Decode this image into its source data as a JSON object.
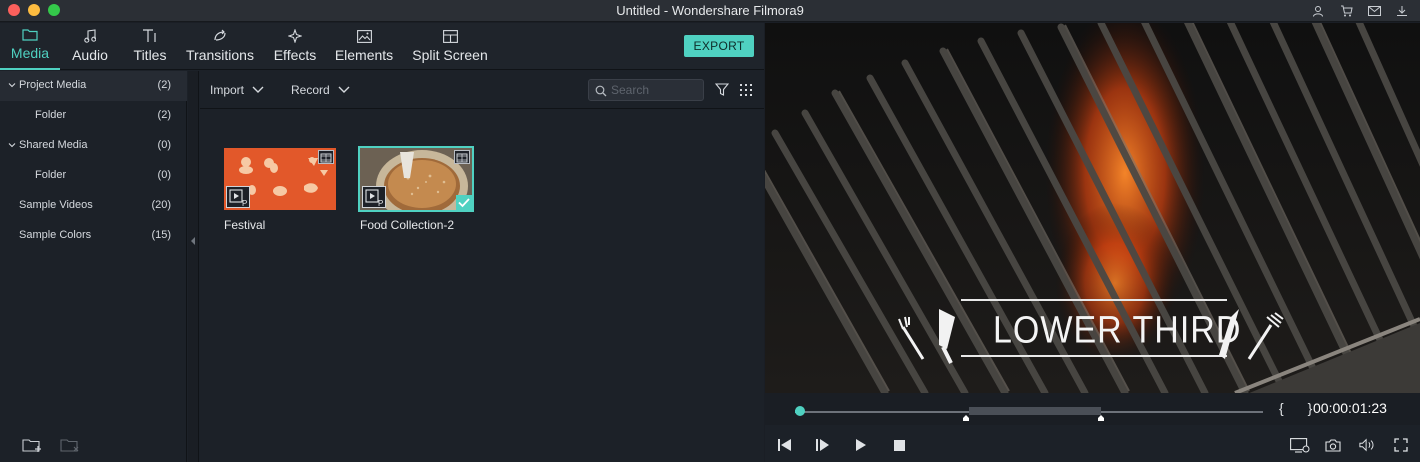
{
  "window": {
    "title": "Untitled - Wondershare Filmora9",
    "right_icons": [
      "user-icon",
      "cart-icon",
      "mail-icon",
      "download-icon"
    ]
  },
  "tabs": [
    {
      "label": "Media",
      "icon": "folder-icon",
      "active": true
    },
    {
      "label": "Audio",
      "icon": "music-note-icon",
      "active": false
    },
    {
      "label": "Titles",
      "icon": "text-title-icon",
      "active": false
    },
    {
      "label": "Transitions",
      "icon": "transition-icon",
      "active": false
    },
    {
      "label": "Effects",
      "icon": "effects-sparkle-icon",
      "active": false
    },
    {
      "label": "Elements",
      "icon": "image-elements-icon",
      "active": false
    },
    {
      "label": "Split Screen",
      "icon": "split-screen-icon",
      "active": false
    }
  ],
  "export_label": "EXPORT",
  "sidebar": {
    "items": [
      {
        "label": "Project Media",
        "count": "(2)",
        "expandable": true,
        "selected": true
      },
      {
        "label": "Folder",
        "count": "(2)",
        "expandable": false,
        "selected": false
      },
      {
        "label": "Shared Media",
        "count": "(0)",
        "expandable": true,
        "selected": false
      },
      {
        "label": "Folder",
        "count": "(0)",
        "expandable": false,
        "selected": false
      },
      {
        "label": "Sample Videos",
        "count": "(20)",
        "expandable": false,
        "selected": false
      },
      {
        "label": "Sample Colors",
        "count": "(15)",
        "expandable": false,
        "selected": false
      }
    ]
  },
  "content_bar": {
    "import_label": "Import",
    "record_label": "Record",
    "search_placeholder": "Search"
  },
  "media": [
    {
      "label": "Festival",
      "selected": false
    },
    {
      "label": "Food Collection-2",
      "selected": true
    }
  ],
  "preview": {
    "overlay_text": "LOWER THIRD",
    "timecode": "00:00:01:23",
    "braces": "{ }",
    "playhead_fraction": 0.0
  },
  "colors": {
    "accent": "#4fd1c1",
    "background": "#1c2128",
    "festival_thumb": "#e2582a"
  }
}
